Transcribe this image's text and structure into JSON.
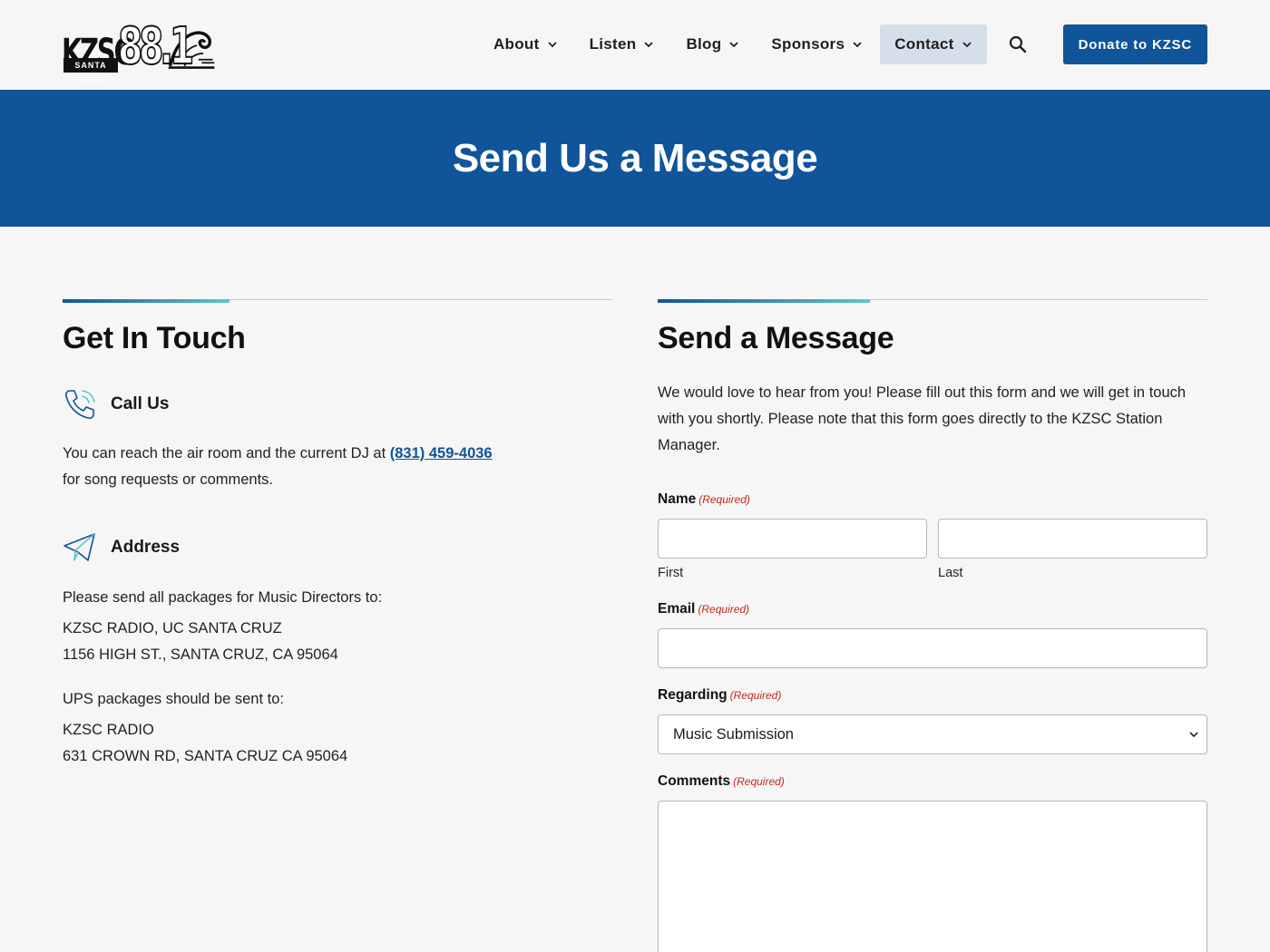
{
  "header": {
    "logo": {
      "text_main": "KZSC",
      "text_sub": "SANTA CRUZ",
      "frequency": "88.1"
    },
    "nav": [
      {
        "label": "About"
      },
      {
        "label": "Listen"
      },
      {
        "label": "Blog"
      },
      {
        "label": "Sponsors"
      },
      {
        "label": "Contact",
        "active": true
      }
    ],
    "donate_label": "Donate to KZSC"
  },
  "hero": {
    "title": "Send Us a Message"
  },
  "left": {
    "title": "Get In Touch",
    "call": {
      "heading": "Call Us",
      "text_before": "You can reach the air room and the current DJ at ",
      "phone": "(831) 459-4036",
      "text_after": "for song requests or comments."
    },
    "address": {
      "heading": "Address",
      "music_intro": "Please send all packages for Music Directors to:",
      "music_line1": "KZSC RADIO, UC SANTA CRUZ",
      "music_line2": "1156 HIGH ST., SANTA CRUZ, CA 95064",
      "ups_intro": "UPS packages should be sent to:",
      "ups_line1": "KZSC RADIO",
      "ups_line2": "631 CROWN RD, SANTA CRUZ CA 95064"
    }
  },
  "form": {
    "title": "Send a Message",
    "intro": "We would love to hear from you! Please fill out this form and we will get in touch with you shortly. Please note that this form goes directly to the KZSC Station Manager.",
    "required_text": "(Required)",
    "name_label": "Name",
    "first_label": "First",
    "last_label": "Last",
    "first_value": "",
    "last_value": "",
    "email_label": "Email",
    "email_value": "",
    "regarding_label": "Regarding",
    "regarding_value": "Music Submission",
    "comments_label": "Comments",
    "comments_value": ""
  },
  "colors": {
    "brand_blue": "#10549a",
    "accent_teal": "#5fc6c7",
    "required_red": "#c02b1d",
    "active_nav_bg": "#d5dfea"
  }
}
